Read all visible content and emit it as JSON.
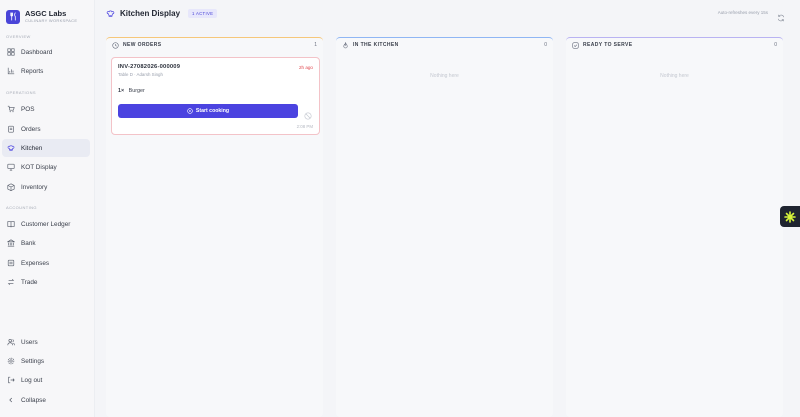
{
  "brand": {
    "name": "ASGC Labs",
    "subtitle": "CULINARY WORKSPACE"
  },
  "sidebar": {
    "sections": [
      "OVERVIEW",
      "OPERATIONS",
      "ACCOUNTING"
    ],
    "items": [
      {
        "label": "Dashboard",
        "icon": "dashboard-icon"
      },
      {
        "label": "Reports",
        "icon": "chart-icon"
      },
      {
        "label": "POS",
        "icon": "cart-icon"
      },
      {
        "label": "Orders",
        "icon": "clipboard-icon"
      },
      {
        "label": "Kitchen",
        "icon": "chef-hat-icon",
        "active": true
      },
      {
        "label": "KOT Display",
        "icon": "monitor-icon"
      },
      {
        "label": "Inventory",
        "icon": "box-icon"
      },
      {
        "label": "Customer Ledger",
        "icon": "book-icon"
      },
      {
        "label": "Bank",
        "icon": "bank-icon"
      },
      {
        "label": "Expenses",
        "icon": "receipt-icon"
      },
      {
        "label": "Trade",
        "icon": "swap-icon"
      }
    ],
    "bottom": [
      {
        "label": "Users",
        "icon": "users-icon"
      },
      {
        "label": "Settings",
        "icon": "gear-icon"
      },
      {
        "label": "Log out",
        "icon": "logout-icon"
      },
      {
        "label": "Collapse",
        "icon": "chevron-left-icon"
      }
    ]
  },
  "header": {
    "title": "Kitchen Display",
    "badge": "1 ACTIVE",
    "auto_refresh": "Auto-refreshes every 15s"
  },
  "columns": [
    {
      "title": "NEW ORDERS",
      "count": "1",
      "accent": "#f6c77a",
      "orders": [
        {
          "invoice": "INV-27082026-000009",
          "ago": "2h ago",
          "table": "Table D · Adarsh Singh",
          "items": [
            {
              "qty": "1×",
              "name": "Burger"
            }
          ],
          "action": "Start cooking",
          "time": "2:08 PM"
        }
      ]
    },
    {
      "title": "IN THE KITCHEN",
      "count": "0",
      "accent": "#8fb6f4",
      "empty": "Nothing here"
    },
    {
      "title": "READY TO SERVE",
      "count": "0",
      "accent": "#b9b3f2",
      "empty": "Nothing here"
    }
  ],
  "colors": {
    "accent": "#4b43e0",
    "danger": "#e0484f"
  }
}
